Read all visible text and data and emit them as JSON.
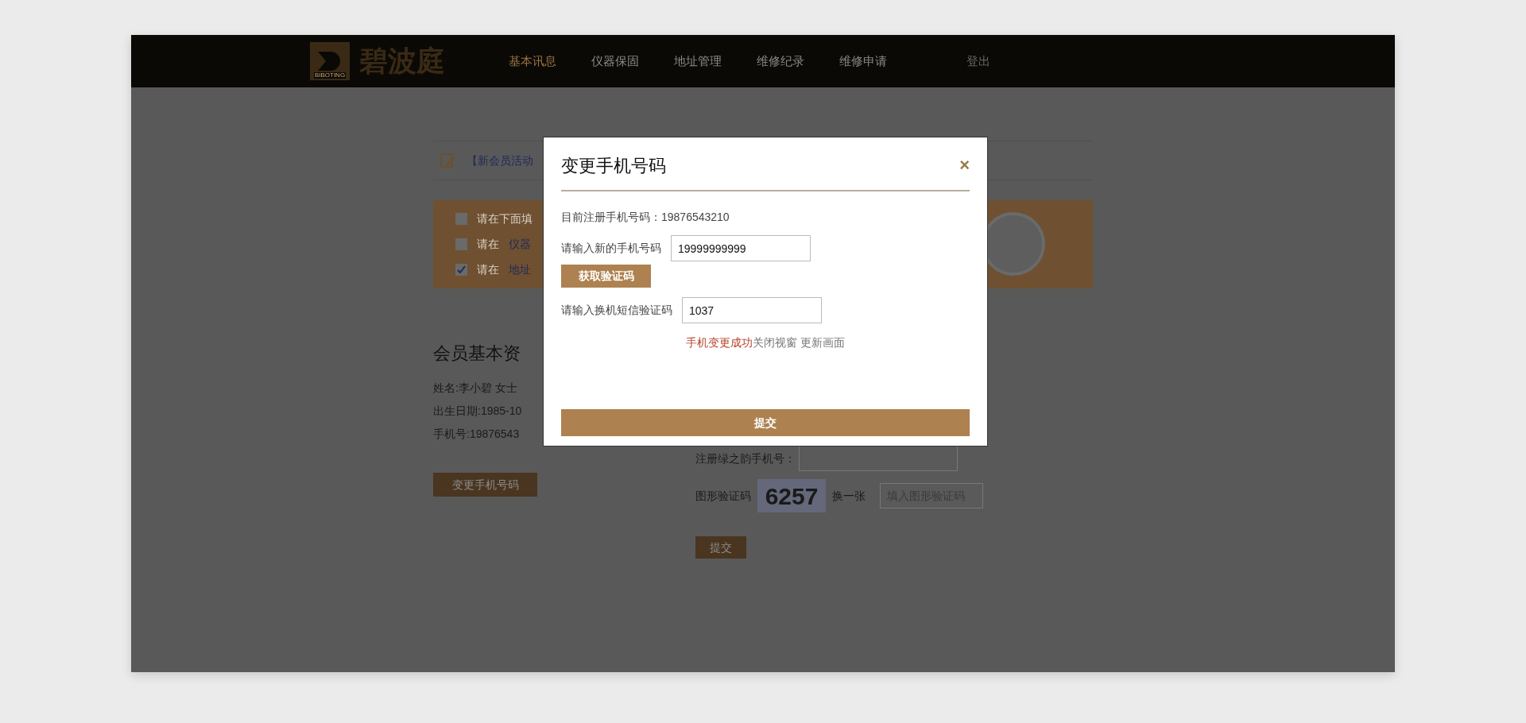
{
  "header": {
    "logo": {
      "name": "碧波庭",
      "subtext": "BIBOTING"
    },
    "nav": [
      {
        "label": "基本讯息",
        "selected": true
      },
      {
        "label": "仪器保固",
        "selected": false
      },
      {
        "label": "地址管理",
        "selected": false
      },
      {
        "label": "维修纪录",
        "selected": false
      },
      {
        "label": "维修申请",
        "selected": false
      }
    ],
    "logout": "登出"
  },
  "notice": {
    "text": "【新会员活动"
  },
  "banner": {
    "items": [
      {
        "prefix": "请在下面填",
        "checked": false
      },
      {
        "prefix": "请在",
        "link": "仪器",
        "checked": false
      },
      {
        "prefix": "请在",
        "link": "地址",
        "checked": true
      }
    ]
  },
  "profile": {
    "title": "会员基本资",
    "lines": [
      "姓名:李小碧 女士",
      "出生日期:1985-10",
      "手机号:19876543"
    ],
    "button": "变更手机号码"
  },
  "form": {
    "phone_label": "注册绿之韵手机号：",
    "captcha_label": "图形验证码",
    "captcha_code": "6257",
    "refresh": "换一张",
    "captcha_placeholder": "填入图形验证码",
    "submit": "提交"
  },
  "modal": {
    "title": "变更手机号码",
    "close": "×",
    "current": "目前注册手机号码：19876543210",
    "new_label": "请输入新的手机号码",
    "new_value": "19999999999",
    "get_code": "获取验证码",
    "code_label": "请输入换机短信验证码",
    "code_value": "1037",
    "success": "手机变更成功",
    "success_note": "关闭视窗 更新画面",
    "submit": "提交"
  }
}
